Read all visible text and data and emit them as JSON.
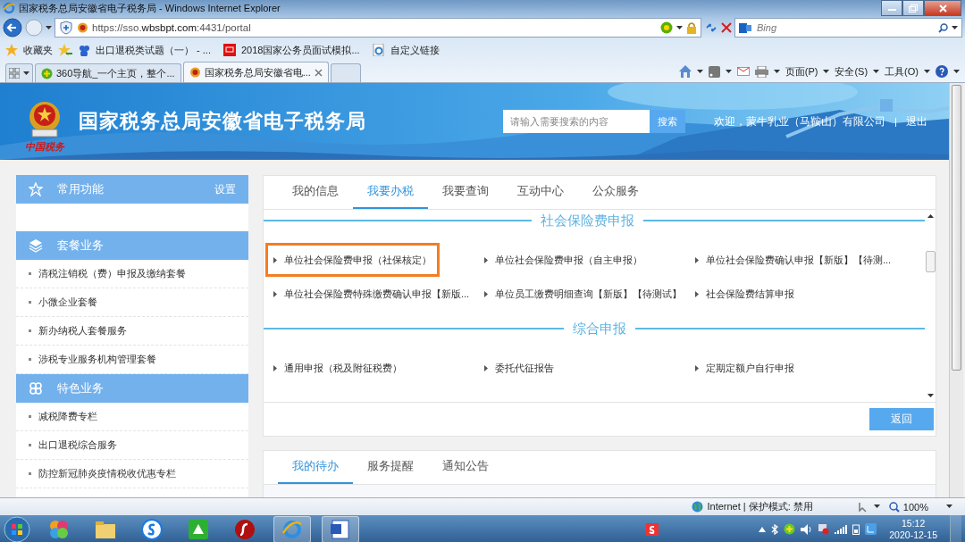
{
  "window": {
    "title": "国家税务总局安徽省电子税务局 - Windows Internet Explorer"
  },
  "address_bar": {
    "url": "https://sso.wbsbpt.com:4431/portal"
  },
  "search_box": {
    "placeholder": "Bing"
  },
  "favorites": {
    "label": "收藏夹",
    "links": [
      "出口退税类试题（一） - ...",
      "2018国家公务员面试模拟...",
      "自定义链接"
    ]
  },
  "tabs": [
    {
      "label": "360导航_一个主页，整个...",
      "selected": false
    },
    {
      "label": "国家税务总局安徽省电...",
      "selected": true
    }
  ],
  "command_bar": [
    "页面(P)",
    "安全(S)",
    "工具(O)"
  ],
  "site": {
    "logo_text": "中国税务",
    "title": "国家税务总局安徽省电子税务局",
    "search": {
      "placeholder": "请输入需要搜索的内容",
      "button": "搜索"
    },
    "welcome": "欢迎，蒙牛乳业（马鞍山）有限公司",
    "separator": "|",
    "logout": "退出"
  },
  "sidebar": [
    {
      "title": "常用功能",
      "action": "设置"
    },
    {
      "title": "套餐业务",
      "items": [
        "清税注销税（费）申报及缴纳套餐",
        "小微企业套餐",
        "新办纳税人套餐服务",
        "涉税专业服务机构管理套餐"
      ]
    },
    {
      "title": "特色业务",
      "items": [
        "减税降费专栏",
        "出口退税综合服务",
        "防控新冠肺炎疫情税收优惠专栏"
      ]
    }
  ],
  "main_tabs": [
    {
      "label": "我的信息",
      "selected": false
    },
    {
      "label": "我要办税",
      "selected": true
    },
    {
      "label": "我要查询",
      "selected": false
    },
    {
      "label": "互动中心",
      "selected": false
    },
    {
      "label": "公众服务",
      "selected": false
    }
  ],
  "sections": [
    {
      "title": "社会保险费申报",
      "items": [
        {
          "label": "单位社会保险费申报（社保核定）",
          "highlighted": true
        },
        {
          "label": "单位社会保险费申报（自主申报）",
          "highlighted": false
        },
        {
          "label": "单位社会保险费确认申报【新版】【待测...",
          "highlighted": false
        },
        {
          "label": "单位社会保险费特殊缴费确认申报【新版...",
          "highlighted": false
        },
        {
          "label": "单位员工缴费明细查询【新版】【待测试】",
          "highlighted": false
        },
        {
          "label": "社会保险费结算申报",
          "highlighted": false
        }
      ]
    },
    {
      "title": "综合申报",
      "items": [
        {
          "label": "通用申报（税及附征税费）",
          "highlighted": false
        },
        {
          "label": "委托代征报告",
          "highlighted": false
        },
        {
          "label": "定期定额户自行申报",
          "highlighted": false
        }
      ]
    }
  ],
  "back_button": "返回",
  "todo_tabs": [
    {
      "label": "我的待办",
      "selected": true
    },
    {
      "label": "服务提醒",
      "selected": false
    },
    {
      "label": "通知公告",
      "selected": false
    }
  ],
  "status_bar": {
    "zone": "Internet | 保护模式: 禁用",
    "zoom": "100%"
  },
  "taskbar": {
    "time": "15:12",
    "date": "2020-12-15"
  }
}
